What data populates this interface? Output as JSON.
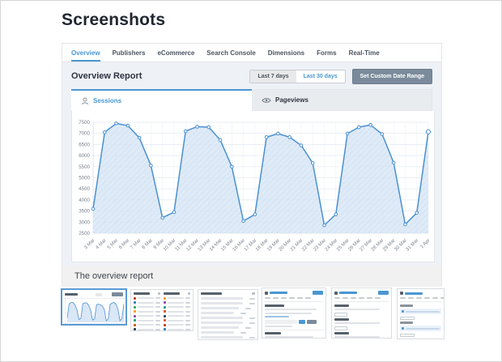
{
  "page_title": "Screenshots",
  "caption": "The overview report",
  "colors": {
    "accent": "#4a97d2",
    "chart_line": "#4a90d2",
    "chart_fill": "#d9e7f6",
    "slate_button": "#7b8b9b",
    "report_bg": "#eef2f7",
    "caption_bg": "#f1f1f1"
  },
  "main_tabs": {
    "items": [
      {
        "label": "Overview",
        "active": true
      },
      {
        "label": "Publishers",
        "active": false
      },
      {
        "label": "eCommerce",
        "active": false
      },
      {
        "label": "Search Console",
        "active": false
      },
      {
        "label": "Dimensions",
        "active": false
      },
      {
        "label": "Forms",
        "active": false
      },
      {
        "label": "Real-Time",
        "active": false
      }
    ]
  },
  "report": {
    "title": "Overview Report",
    "date_buttons": [
      {
        "label": "Last 7 days",
        "active": false
      },
      {
        "label": "Last 30 days",
        "active": true
      }
    ],
    "custom_range_label": "Set Custom Date Range",
    "metric_tabs": [
      {
        "label": "Sessions",
        "icon": "person-icon",
        "active": true
      },
      {
        "label": "Pageviews",
        "icon": "eye-icon",
        "active": false
      }
    ]
  },
  "chart_data": {
    "type": "area",
    "title": "Sessions",
    "x": [
      "3 Mar",
      "4 Mar",
      "5 Mar",
      "6 Mar",
      "7 Mar",
      "8 Mar",
      "9 Mar",
      "10 Mar",
      "11 Mar",
      "12 Mar",
      "13 Mar",
      "14 Mar",
      "15 Mar",
      "16 Mar",
      "17 Mar",
      "18 Mar",
      "19 Mar",
      "20 Mar",
      "21 Mar",
      "22 Mar",
      "23 Mar",
      "24 Mar",
      "25 Mar",
      "26 Mar",
      "27 Mar",
      "28 Mar",
      "29 Mar",
      "30 Mar",
      "31 Mar",
      "1 Apr"
    ],
    "series": [
      {
        "name": "Sessions",
        "values": [
          3600,
          7050,
          7450,
          7350,
          6800,
          5550,
          3200,
          3450,
          7100,
          7300,
          7280,
          6700,
          5500,
          3050,
          3350,
          6830,
          6990,
          6830,
          6460,
          5660,
          2860,
          3350,
          6990,
          7280,
          7380,
          6970,
          5680,
          2900,
          3420,
          7070
        ]
      }
    ],
    "ylim": [
      2500,
      7500
    ],
    "ytick_step": 500,
    "grid": true,
    "legend": "none",
    "xlabel": "",
    "ylabel": ""
  },
  "thumbnails": [
    {
      "name": "thumbnail-overview-chart",
      "kind": "chart",
      "selected": true
    },
    {
      "name": "thumbnail-two-column-lists",
      "kind": "dual-list",
      "selected": false
    },
    {
      "name": "thumbnail-single-list",
      "kind": "list",
      "selected": false
    },
    {
      "name": "thumbnail-settings-1",
      "kind": "settings-a",
      "selected": false
    },
    {
      "name": "thumbnail-settings-2",
      "kind": "settings-b",
      "selected": false
    },
    {
      "name": "thumbnail-settings-3",
      "kind": "checklist",
      "selected": false
    }
  ]
}
